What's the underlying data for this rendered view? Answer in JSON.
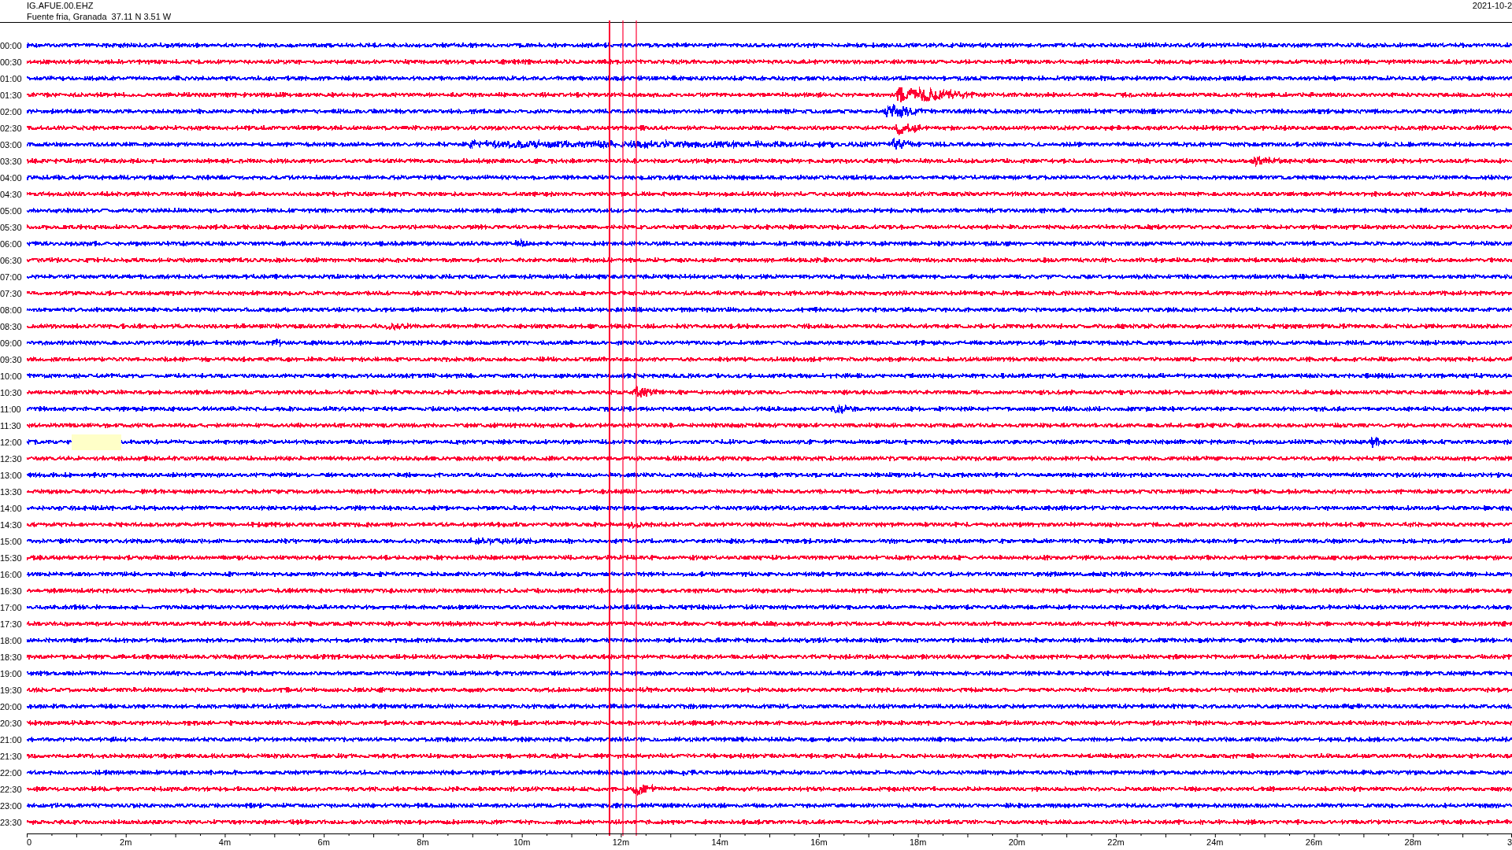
{
  "header": {
    "station": "IG.AFUE.00.EHZ",
    "location": "Fuente fria, Granada  37.11 N 3.51 W",
    "date": "2021-10-2"
  },
  "rows": [
    {
      "label": "00:00",
      "color": "#0000ff"
    },
    {
      "label": "00:30",
      "color": "#ff0033"
    },
    {
      "label": "01:00",
      "color": "#0000ff"
    },
    {
      "label": "01:30",
      "color": "#ff0033"
    },
    {
      "label": "02:00",
      "color": "#0000ff"
    },
    {
      "label": "02:30",
      "color": "#ff0033"
    },
    {
      "label": "03:00",
      "color": "#0000ff"
    },
    {
      "label": "03:30",
      "color": "#ff0033"
    },
    {
      "label": "04:00",
      "color": "#0000ff"
    },
    {
      "label": "04:30",
      "color": "#ff0033"
    },
    {
      "label": "05:00",
      "color": "#0000ff"
    },
    {
      "label": "05:30",
      "color": "#ff0033"
    },
    {
      "label": "06:00",
      "color": "#0000ff"
    },
    {
      "label": "06:30",
      "color": "#ff0033"
    },
    {
      "label": "07:00",
      "color": "#0000ff"
    },
    {
      "label": "07:30",
      "color": "#ff0033"
    },
    {
      "label": "08:00",
      "color": "#0000ff"
    },
    {
      "label": "08:30",
      "color": "#ff0033"
    },
    {
      "label": "09:00",
      "color": "#0000ff"
    },
    {
      "label": "09:30",
      "color": "#ff0033"
    },
    {
      "label": "10:00",
      "color": "#0000ff"
    },
    {
      "label": "10:30",
      "color": "#ff0033"
    },
    {
      "label": "11:00",
      "color": "#0000ff"
    },
    {
      "label": "11:30",
      "color": "#ff0033"
    },
    {
      "label": "12:00",
      "color": "#0000ff"
    },
    {
      "label": "12:30",
      "color": "#ff0033"
    },
    {
      "label": "13:00",
      "color": "#0000ff"
    },
    {
      "label": "13:30",
      "color": "#ff0033"
    },
    {
      "label": "14:00",
      "color": "#0000ff"
    },
    {
      "label": "14:30",
      "color": "#ff0033"
    },
    {
      "label": "15:00",
      "color": "#0000ff"
    },
    {
      "label": "15:30",
      "color": "#ff0033"
    },
    {
      "label": "16:00",
      "color": "#0000ff"
    },
    {
      "label": "16:30",
      "color": "#ff0033"
    },
    {
      "label": "17:00",
      "color": "#0000ff"
    },
    {
      "label": "17:30",
      "color": "#ff0033"
    },
    {
      "label": "18:00",
      "color": "#0000ff"
    },
    {
      "label": "18:30",
      "color": "#ff0033"
    },
    {
      "label": "19:00",
      "color": "#0000ff"
    },
    {
      "label": "19:30",
      "color": "#ff0033"
    },
    {
      "label": "20:00",
      "color": "#0000ff"
    },
    {
      "label": "20:30",
      "color": "#ff0033"
    },
    {
      "label": "21:00",
      "color": "#0000ff"
    },
    {
      "label": "21:30",
      "color": "#ff0033"
    },
    {
      "label": "22:00",
      "color": "#0000ff"
    },
    {
      "label": "22:30",
      "color": "#ff0033"
    },
    {
      "label": "23:00",
      "color": "#0000ff"
    },
    {
      "label": "23:30",
      "color": "#ff0033"
    }
  ],
  "axis": {
    "labels": [
      "0",
      "2m",
      "4m",
      "6m",
      "8m",
      "10m",
      "12m",
      "14m",
      "16m",
      "18m",
      "20m",
      "22m",
      "24m",
      "26m",
      "28m",
      "3"
    ]
  }
}
